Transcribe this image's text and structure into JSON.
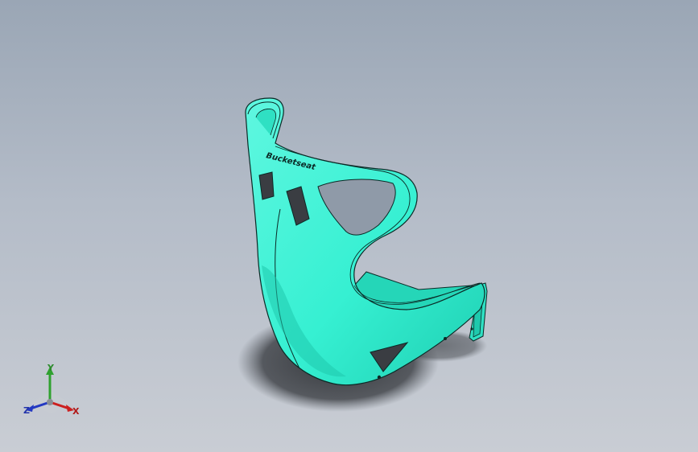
{
  "viewport": {
    "background_top": "#9aa6b5",
    "background_bottom": "#c9cdd4"
  },
  "model": {
    "body_color": "#36f0d2",
    "shade_color": "#1fc9ad",
    "edge_color": "#0b2a26",
    "shadow_color": "#2f3236",
    "brand_text": "Bucketseat",
    "brand_text_readable": false
  },
  "triad": {
    "x_label": "X",
    "y_label": "Y",
    "z_label": "Z",
    "x_color": "#cc1f1f",
    "y_color": "#2fa12f",
    "z_color": "#2338c2"
  }
}
